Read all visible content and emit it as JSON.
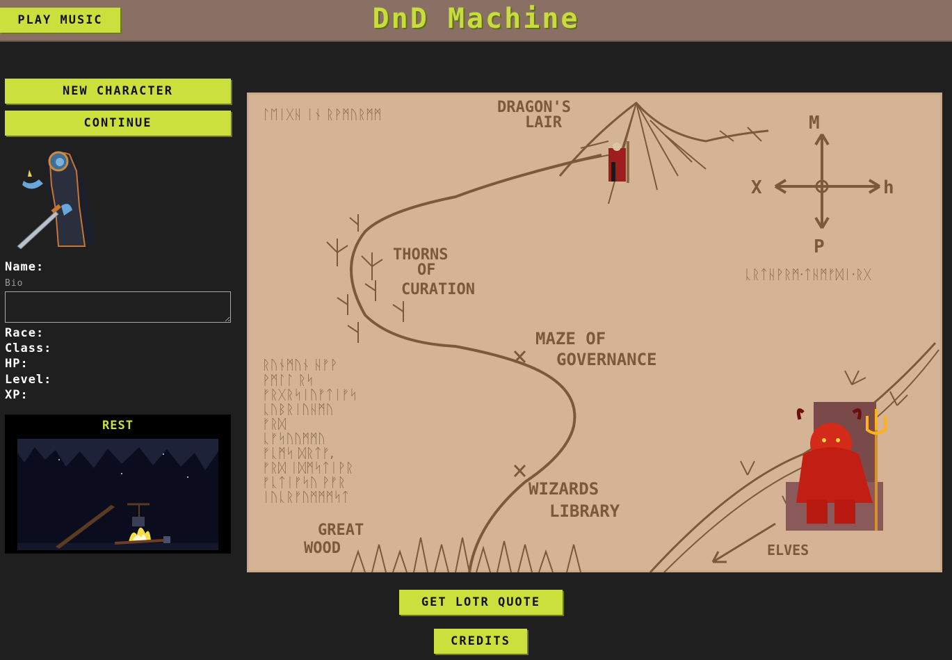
{
  "header": {
    "title": "DnD Machine",
    "play_music": "PLAY MUSIC"
  },
  "sidebar": {
    "new_character": "NEW CHARACTER",
    "continue": "CONTINUE",
    "stats": {
      "name": "Name:",
      "bio_placeholder": "Bio",
      "race": "Race:",
      "class": "Class:",
      "hp": "HP:",
      "level": "Level:",
      "xp": "XP:"
    },
    "rest_label": "REST"
  },
  "map": {
    "labels": {
      "dragons_lair_1": "DRAGON'S",
      "dragons_lair_2": "LAIR",
      "thorns_1": "THORNS",
      "thorns_2": "OF",
      "thorns_3": "CURATION",
      "maze_1": "MAZE OF",
      "maze_2": "GOVERNANCE",
      "wizards_1": "WIZARDS",
      "wizards_2": "LIBRARY",
      "great_wood_1": "GREAT",
      "great_wood_2": "WOOD",
      "elves": "ELVES",
      "compass_n": "M",
      "compass_w": "X",
      "compass_e": "h",
      "compass_s": "P",
      "runes_top": "ᛚᛖᛁᚷᚺ ᛁᚾ ᚱᚹᛗᚢᚱᛗᛗ",
      "runes_right": "ᚳᚱᛏᚺᚹᚱᛗ·ᛏᚺᛗᚠᛞᛁ·ᚱᚷ",
      "runes_left": [
        "ᚱᚢᚾᛗᚢᚾ ᚺᚠᚹ",
        "ᚹᛗᛚᛚ ᚱᛋ",
        "ᚠᚱᚷᚱᛋᛁᚢᚠᛏᛁᚠᛋ",
        "ᚳᚢᛒᚱᛁᚢᚺᛗᚢ",
        "ᚠᚱᛞ",
        "ᚳᚠᛋᚢᚢᛗᛗᚢ",
        "ᚠᚳᛗᛋ ᛞᚱᛏᚠ,",
        "ᚠᚱᛞ ᛁᛞᛗᛋᛏᛁᚹᚱ",
        "ᚠᚳᛏᛁᚠᛋᚢ ᚹᚠᚱ",
        "ᛁᚢᚳᚱᚠᚢᛗᛗᛗᛋᛏ"
      ]
    }
  },
  "footer": {
    "quote": "GET LOTR QUOTE",
    "credits": "CREDITS"
  },
  "colors": {
    "accent": "#cbe03c",
    "header_bg": "#8a6f65",
    "page_bg": "#1f1f1f",
    "map_bg": "#d6b596",
    "ink": "#7a5a3a"
  }
}
